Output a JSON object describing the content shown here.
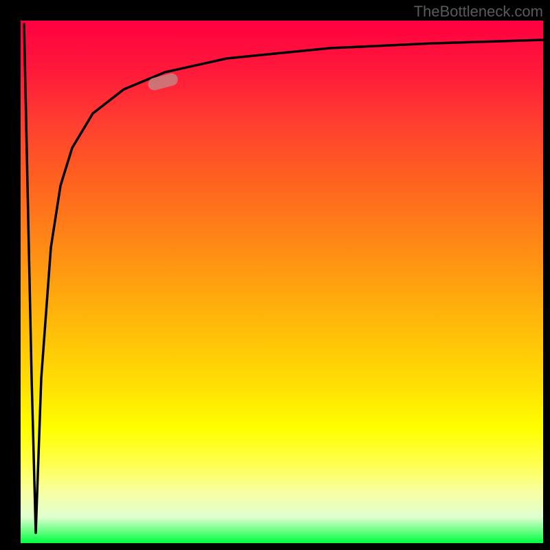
{
  "watermark": "TheBottleneck.com",
  "chart_data": {
    "type": "line",
    "title": "",
    "xlabel": "",
    "ylabel": "",
    "xlim": [
      0,
      100
    ],
    "ylim": [
      0,
      100
    ],
    "grid": false,
    "annotations": [
      {
        "name": "highlight-marker",
        "x": 27,
        "y": 88,
        "color": "#c58080"
      }
    ],
    "series": [
      {
        "name": "bottleneck-curve",
        "type": "line",
        "color": "#000000",
        "x": [
          0,
          2,
          3,
          4,
          6,
          8,
          10,
          14,
          20,
          28,
          40,
          60,
          80,
          100
        ],
        "y": [
          99,
          30,
          2,
          30,
          55,
          68,
          75,
          82,
          87,
          90,
          92.5,
          94.5,
          95.5,
          96
        ]
      }
    ],
    "background_gradient": {
      "type": "vertical",
      "stops": [
        {
          "pos": 0.0,
          "color": "#ff0040"
        },
        {
          "pos": 0.5,
          "color": "#ffa010"
        },
        {
          "pos": 0.78,
          "color": "#ffff00"
        },
        {
          "pos": 1.0,
          "color": "#00ff40"
        }
      ]
    }
  }
}
